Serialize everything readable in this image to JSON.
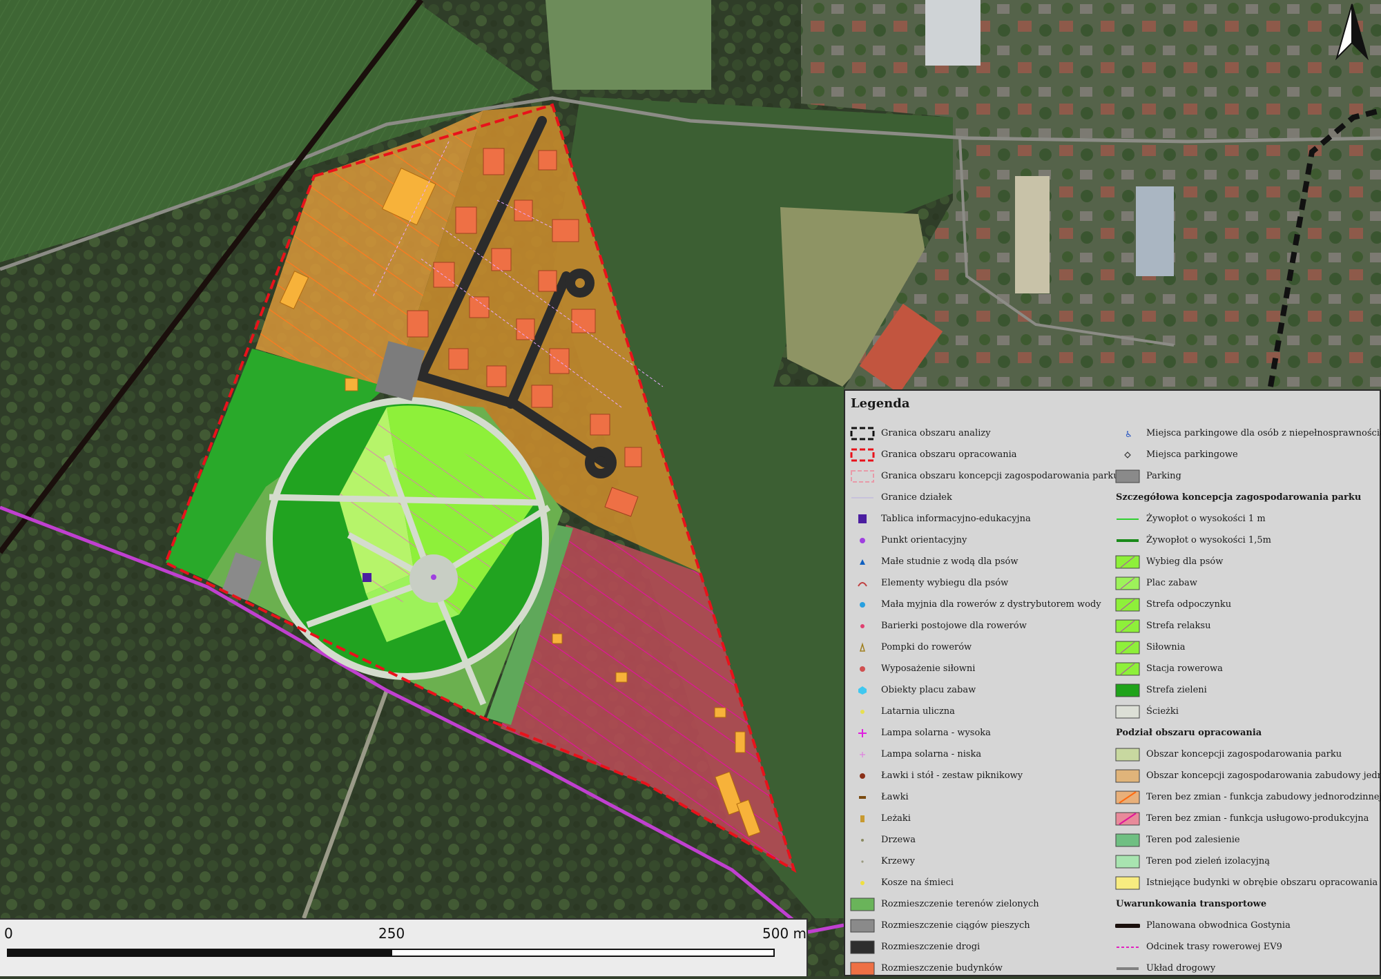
{
  "legend": {
    "title": "Legenda",
    "left_items": [
      {
        "label": "Granica obszaru analizy",
        "icon": "black-dashed-outline"
      },
      {
        "label": "Granica obszaru opracowania",
        "icon": "red-dashed-outline"
      },
      {
        "label": "Granica obszaru koncepcji zagospodarowania parku",
        "icon": "pink-dashed-outline"
      },
      {
        "label": "Granice działek",
        "icon": "thin-line"
      },
      {
        "label": "Tablica informacyjno-edukacyjna",
        "icon": "info-board-icon"
      },
      {
        "label": "Punkt orientacyjny",
        "icon": "purple-dot"
      },
      {
        "label": "Małe studnie z wodą dla psów",
        "icon": "water-well-icon"
      },
      {
        "label": "Elementy wybiegu dla psów",
        "icon": "dog-run-element-icon"
      },
      {
        "label": "Mała myjnia dla rowerów z dystrybutorem wody",
        "icon": "bike-wash-icon"
      },
      {
        "label": "Barierki postojowe dla rowerów",
        "icon": "bike-rack-icon"
      },
      {
        "label": "Pompki do rowerów",
        "icon": "bike-pump-icon"
      },
      {
        "label": "Wyposażenie siłowni",
        "icon": "gym-equipment-icon"
      },
      {
        "label": "Obiekty placu zabaw",
        "icon": "playground-object-icon"
      },
      {
        "label": "Latarnia uliczna",
        "icon": "street-lamp-icon"
      },
      {
        "label": "Lampa solarna - wysoka",
        "icon": "solar-lamp-high-icon"
      },
      {
        "label": "Lampa solarna - niska",
        "icon": "solar-lamp-low-icon"
      },
      {
        "label": "Ławki i stół - zestaw piknikowy",
        "icon": "picnic-set-icon"
      },
      {
        "label": "Ławki",
        "icon": "bench-icon"
      },
      {
        "label": "Leżaki",
        "icon": "deckchair-icon"
      },
      {
        "label": "Drzewa",
        "icon": "tree-icon"
      },
      {
        "label": "Krzewy",
        "icon": "shrub-icon"
      },
      {
        "label": "Kosze na śmieci",
        "icon": "trash-bin-icon"
      },
      {
        "label": "Rozmieszczenie terenów zielonych",
        "icon": "green-area-swatch"
      },
      {
        "label": "Rozmieszczenie ciągów pieszych",
        "icon": "footpath-swatch"
      },
      {
        "label": "Rozmieszczenie drogi",
        "icon": "road-swatch"
      },
      {
        "label": "Rozmieszczenie budynków",
        "icon": "building-swatch"
      }
    ],
    "right_items": [
      {
        "label": "Miejsca parkingowe dla osób z niepełnosprawnością",
        "icon": "disabled-parking-icon"
      },
      {
        "label": "Miejsca parkingowe",
        "icon": "parking-space-icon"
      },
      {
        "label": "Parking",
        "icon": "parking-swatch"
      },
      {
        "heading": "Szczegółowa koncepcja zagospodarowania parku"
      },
      {
        "label": "Żywopłot o wysokości 1 m",
        "icon": "hedge-1m-line"
      },
      {
        "label": "Żywopłot o wysokości 1,5m",
        "icon": "hedge-15m-line"
      },
      {
        "label": "Wybieg dla psów",
        "icon": "dog-run-swatch"
      },
      {
        "label": "Plac zabaw",
        "icon": "playground-swatch"
      },
      {
        "label": "Strefa odpoczynku",
        "icon": "rest-zone-swatch"
      },
      {
        "label": "Strefa relaksu",
        "icon": "relax-zone-swatch"
      },
      {
        "label": "Siłownia",
        "icon": "gym-swatch"
      },
      {
        "label": "Stacja rowerowa",
        "icon": "bike-station-swatch"
      },
      {
        "label": "Strefa zieleni",
        "icon": "green-zone-swatch"
      },
      {
        "label": "Ścieżki",
        "icon": "paths-swatch"
      },
      {
        "heading": "Podział obszaru opracowania"
      },
      {
        "label": "Obszar koncepcji zagospodarowania parku",
        "icon": "park-concept-swatch"
      },
      {
        "label": "Obszar koncepcji zagospodarowania zabudowy jednorodzinnej",
        "icon": "housing-concept-swatch"
      },
      {
        "label": "Teren bez zmian - funkcja zabudowy jednorodzinnej",
        "icon": "housing-unchanged-swatch"
      },
      {
        "label": "Teren bez zmian - funkcja usługowo-produkcyjna",
        "icon": "services-unchanged-swatch"
      },
      {
        "label": "Teren pod zalesienie",
        "icon": "afforestation-swatch"
      },
      {
        "label": "Teren pod zieleń izolacyjną",
        "icon": "isolation-green-swatch"
      },
      {
        "label": "Istniejące budynki w obrębie obszaru opracowania",
        "icon": "existing-buildings-swatch"
      },
      {
        "heading": "Uwarunkowania transportowe"
      },
      {
        "label": "Planowana obwodnica Gostynia",
        "icon": "bypass-line"
      },
      {
        "label": "Odcinek trasy rowerowej EV9",
        "icon": "ev9-route-line"
      },
      {
        "label": "Układ drogowy",
        "icon": "road-network-line"
      }
    ]
  },
  "scale": {
    "label_start": "0",
    "label_mid": "250",
    "label_end": "500 m"
  },
  "colors": {
    "study_boundary": "#e8121b",
    "analysis_boundary": "#111111",
    "housing_concept": "#d99a3a",
    "housing_unchanged_hatch": "#f07c2a",
    "services_unchanged": "#c8506a",
    "services_hatch": "#e0149a",
    "green_zone": "#1fa31a",
    "light_green": "#8ef03a",
    "path": "#cfd8c8",
    "road": "#2e2e2e",
    "building": "#ee7045",
    "existing_building": "#f7b23a",
    "ev9_route": "#c040d0"
  }
}
